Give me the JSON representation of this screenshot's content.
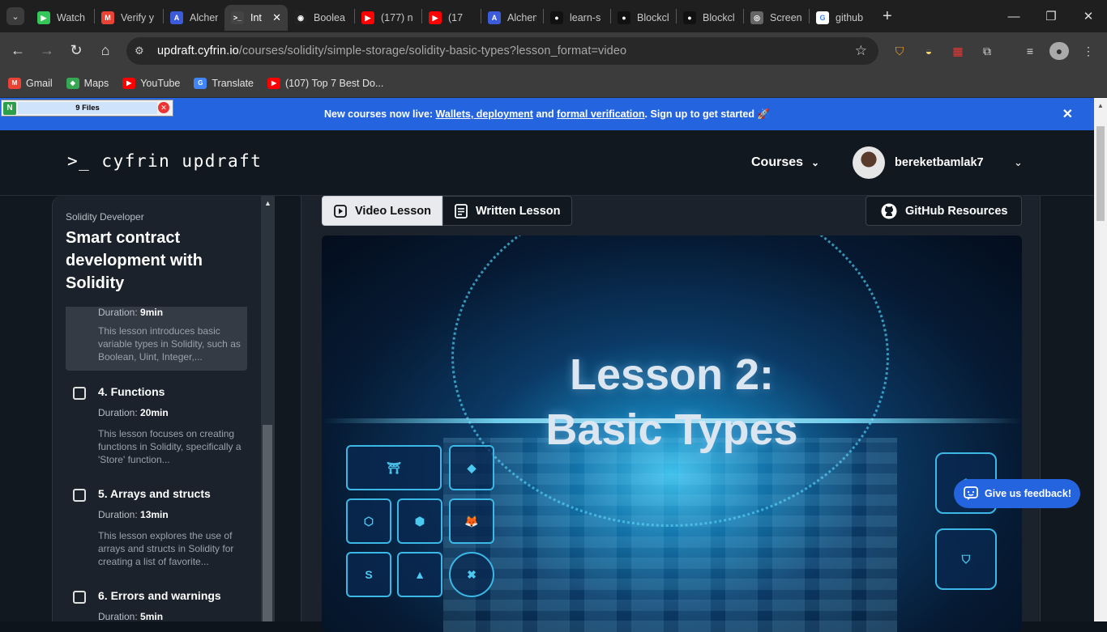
{
  "browser": {
    "tabs": [
      {
        "label": "Watch",
        "color": "#34c759",
        "glyph": "▶"
      },
      {
        "label": "Verify y",
        "color": "#ea4335",
        "glyph": "M"
      },
      {
        "label": "Alchem",
        "color": "#3b5bdb",
        "glyph": "A"
      },
      {
        "label": "Int",
        "color": "#444",
        "glyph": ">_",
        "active": true
      },
      {
        "label": "Boolea",
        "color": "#222",
        "glyph": "◉"
      },
      {
        "label": "(177) n",
        "color": "#ff0000",
        "glyph": "▶"
      },
      {
        "label": "(17",
        "color": "#ff0000",
        "glyph": "▶"
      },
      {
        "label": "Alchem",
        "color": "#3b5bdb",
        "glyph": "A"
      },
      {
        "label": "learn-s",
        "color": "#111",
        "glyph": "●"
      },
      {
        "label": "Blockcl",
        "color": "#111",
        "glyph": "●"
      },
      {
        "label": "Blockcl",
        "color": "#111",
        "glyph": "●"
      },
      {
        "label": "Screen",
        "color": "#666",
        "glyph": "◎"
      },
      {
        "label": "github",
        "color": "#fff",
        "glyph": "G"
      }
    ],
    "address": {
      "host": "updraft.cyfrin.io",
      "path": "/courses/solidity/simple-storage/solidity-basic-types?lesson_format=video"
    },
    "bookmarks": [
      {
        "label": "Gmail",
        "color": "#ea4335",
        "glyph": "M"
      },
      {
        "label": "Maps",
        "color": "#34a853",
        "glyph": "◆"
      },
      {
        "label": "YouTube",
        "color": "#ff0000",
        "glyph": "▶"
      },
      {
        "label": "Translate",
        "color": "#4285f4",
        "glyph": "G"
      },
      {
        "label": "(107) Top 7 Best Do...",
        "color": "#ff0000",
        "glyph": "▶"
      }
    ]
  },
  "files_widget": {
    "label": "9 Files"
  },
  "banner": {
    "prefix": "New courses now live: ",
    "link1": "Wallets, deployment",
    "mid": " and ",
    "link2": "formal verification",
    "suffix": ". Sign up to get started 🚀"
  },
  "header": {
    "logo": ">_ cyfrin updraft",
    "courses_label": "Courses",
    "username": "bereketbamlak7"
  },
  "sidebar": {
    "eyebrow": "Solidity Developer",
    "title": "Smart contract development with Solidity",
    "active_lesson": {
      "duration_label": "Duration: ",
      "duration": "9min",
      "description": "This lesson introduces basic variable types in Solidity, such as Boolean, Uint, Integer,..."
    },
    "lessons": [
      {
        "title": "4. Functions",
        "duration": "20min",
        "description": "This lesson focuses on creating functions in Solidity, specifically a 'Store' function..."
      },
      {
        "title": "5. Arrays and structs",
        "duration": "13min",
        "description": "This lesson explores the use of arrays and structs in Solidity for creating a list of favorite..."
      },
      {
        "title": "6. Errors and warnings",
        "duration": "5min",
        "description": ""
      }
    ],
    "duration_label": "Duration: "
  },
  "main": {
    "video_tab": "Video Lesson",
    "written_tab": "Written Lesson",
    "github_button": "GitHub Resources",
    "video_title_line1": "Lesson 2:",
    "video_title_line2": "Basic Types"
  },
  "feedback_button": "Give us feedback!",
  "colors": {
    "banner": "#2464de",
    "accent": "#4cc9f0",
    "page_bg": "#121820"
  }
}
